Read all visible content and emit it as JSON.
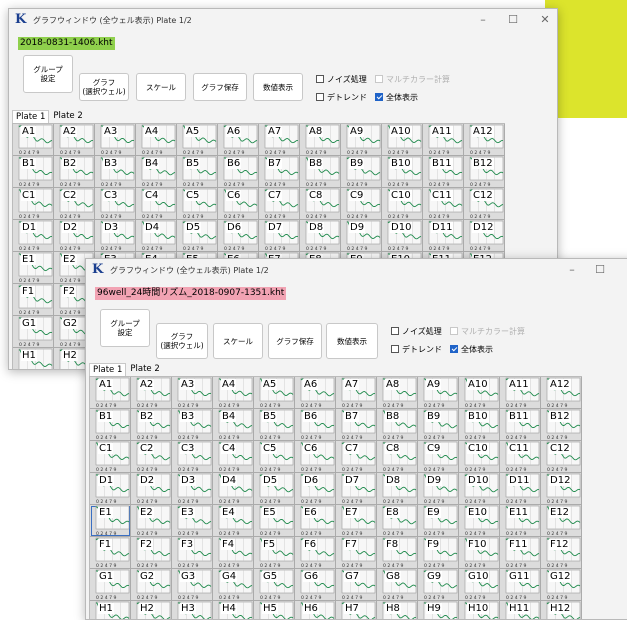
{
  "colors": {
    "accent_yellow": "#dce42c",
    "file_badge_window1": "#8fd04c",
    "file_badge_window2": "#f2a3b3",
    "trace_green": "#1f8a4c",
    "checkbox_blue": "#1f63c8"
  },
  "rows": [
    "A",
    "B",
    "C",
    "D",
    "E",
    "F",
    "G",
    "H"
  ],
  "columns": [
    "1",
    "2",
    "3",
    "4",
    "5",
    "6",
    "7",
    "8",
    "9",
    "10",
    "11",
    "12"
  ],
  "axis_ticks": "0 2 4 7 9",
  "window1": {
    "title": "グラフウィンドウ (全ウェル表示) Plate 1/2",
    "file_name": "2018-0831-1406.kht",
    "buttons": {
      "group": "グループ\n設定",
      "graph_select": "グラフ\n(選択ウェル)",
      "scale": "スケール",
      "save": "グラフ保存",
      "values": "数値表示"
    },
    "checks": {
      "noise": "ノイズ処理",
      "multicolor": "マルチカラー計算",
      "detrend": "デトレンド",
      "show_all": "全体表示"
    },
    "tabs": [
      "Plate 1",
      "Plate 2"
    ],
    "controls": {
      "minimize": "–",
      "maximize": "☐",
      "close": "✕"
    }
  },
  "window2": {
    "title": "グラフウィンドウ (全ウェル表示) Plate 1/2",
    "file_name": "96well_24時間リズム_2018-0907-1351.kht",
    "buttons": {
      "group": "グループ\n設定",
      "graph_select": "グラフ\n(選択ウェル)",
      "scale": "スケール",
      "save": "グラフ保存",
      "values": "数値表示"
    },
    "checks": {
      "noise": "ノイズ処理",
      "multicolor": "マルチカラー計算",
      "detrend": "デトレンド",
      "show_all": "全体表示"
    },
    "tabs": [
      "Plate 1",
      "Plate 2"
    ],
    "controls": {
      "minimize": "–",
      "maximize": "☐"
    },
    "selected_well": "E1"
  }
}
